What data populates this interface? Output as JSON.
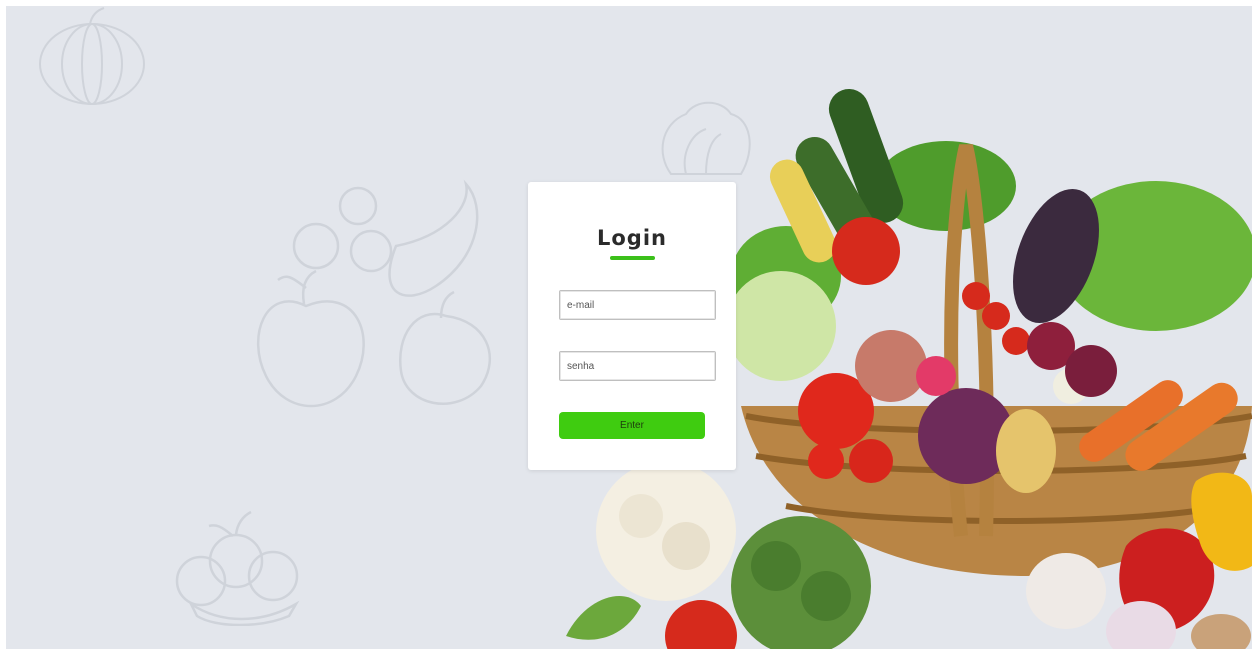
{
  "login": {
    "title": "Login",
    "email_placeholder": "e-mail",
    "password_placeholder": "senha",
    "enter_label": "Enter"
  },
  "colors": {
    "background": "#e3e6ec",
    "accent": "#3fcc10",
    "card": "#ffffff",
    "doodle": "#cfd3da"
  },
  "decorations": {
    "background_doodles": [
      "pumpkin-icon",
      "lettuce-icon",
      "fruit-bundle-icon",
      "fruit-basket-icon"
    ],
    "photo": "vegetable-basket-image"
  }
}
